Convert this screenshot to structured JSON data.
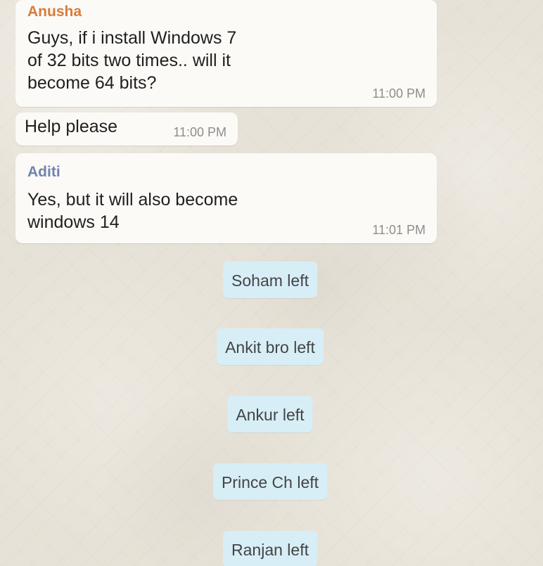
{
  "messages": [
    {
      "sender": "Anusha",
      "text": "Guys, if i install Windows 7\nof 32 bits two times.. will it\nbecome 64 bits?",
      "time": "11:00 PM"
    },
    {
      "text": "Help please",
      "time": "11:00 PM"
    },
    {
      "sender": "Aditi",
      "text": "Yes, but it will also become\nwindows 14",
      "time": "11:01 PM"
    }
  ],
  "system_events": [
    "Soham left",
    "Ankit bro left",
    "Ankur left",
    "Prince Ch left",
    "Ranjan left"
  ],
  "colors": {
    "chat_background": "#e7e2d7",
    "bubble_background": "#fbfaf7",
    "system_pill_background": "#d7eef7",
    "sender_anusha": "#d77c3b",
    "sender_aditi": "#6f83ad",
    "timestamp": "#8d8d8d"
  }
}
